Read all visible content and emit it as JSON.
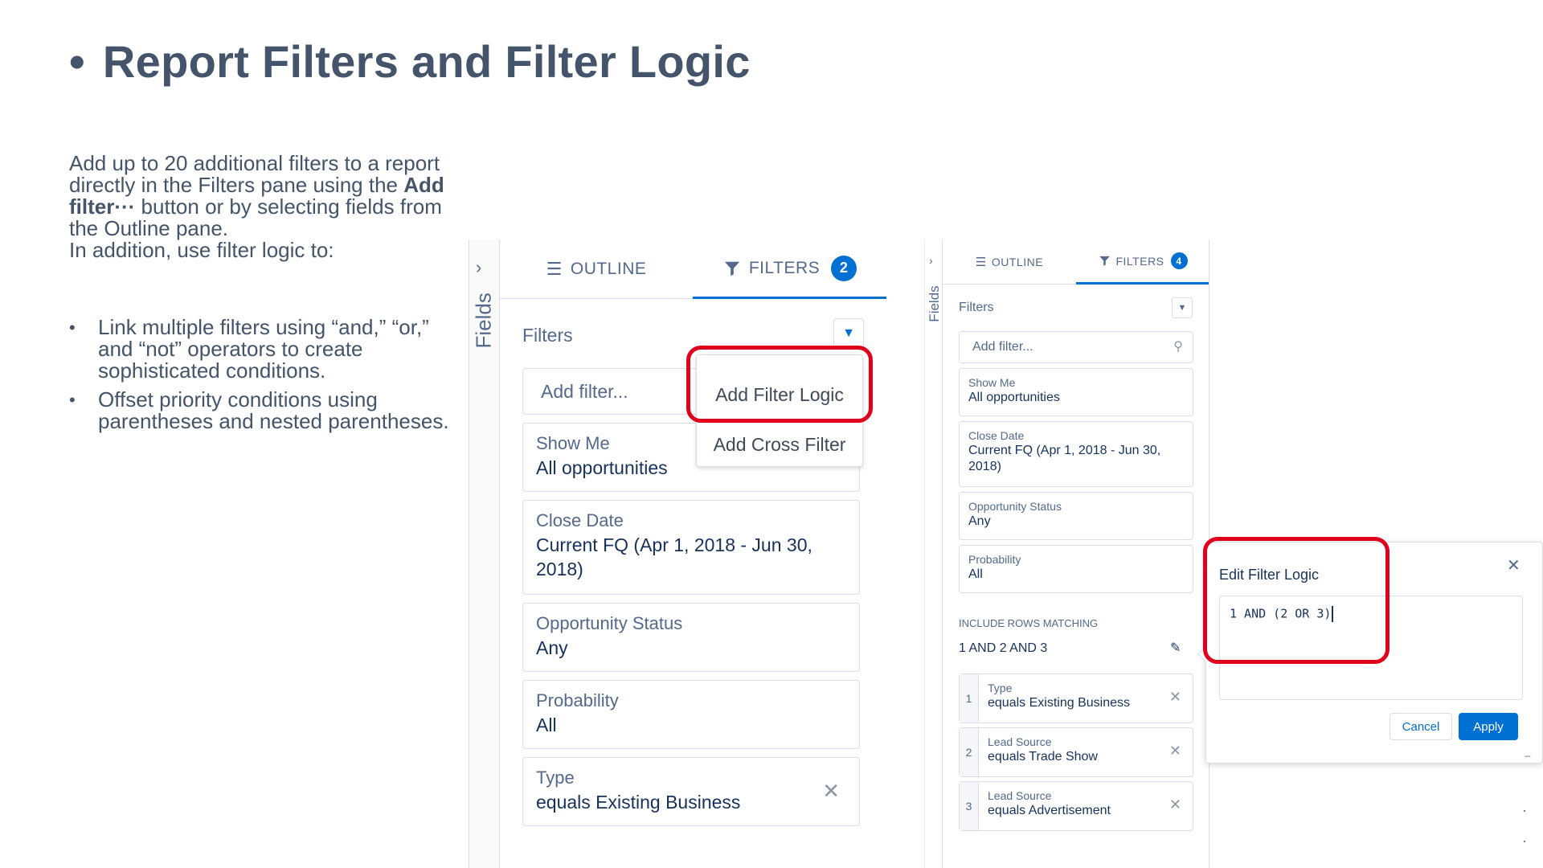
{
  "slide": {
    "title": "Report Filters and Filter Logic",
    "intro_1": "Add up to 20 additional filters to a report directly in the Filters pane using the ",
    "intro_bold": "Add filter···",
    "intro_2": " button or by selecting  fields from the Outline pane.",
    "intro_3": "In addition, use filter logic to:",
    "bullets": [
      "Link multiple filters using “and,” “or,” and “not” operators to create sophisticated conditions.",
      "Offset priority conditions using parentheses and nested parentheses."
    ]
  },
  "left_panel": {
    "rail_label": "Fields",
    "tab_outline": "Outline",
    "tab_filters": "Filters",
    "filters_badge": "2",
    "filters_title": "Filters",
    "add_filter_placeholder": "Add filter...",
    "menu": [
      "Add Filter Logic",
      "Add Cross Filter"
    ],
    "cards": [
      {
        "label": "Show Me",
        "value": "All opportunities"
      },
      {
        "label": "Close Date",
        "value": "Current FQ (Apr 1, 2018 - Jun 30, 2018)"
      },
      {
        "label": "Opportunity Status",
        "value": "Any"
      },
      {
        "label": "Probability",
        "value": "All"
      },
      {
        "label": "Type",
        "value": "equals Existing Business"
      }
    ]
  },
  "right_panel": {
    "rail_label": "Fields",
    "tab_outline": "Outline",
    "tab_filters": "Filters",
    "filters_badge": "4",
    "filters_title": "Filters",
    "add_filter_placeholder": "Add filter...",
    "cards": [
      {
        "label": "Show Me",
        "value": "All opportunities"
      },
      {
        "label": "Close Date",
        "value": "Current FQ (Apr 1, 2018 - Jun 30, 2018)"
      },
      {
        "label": "Opportunity Status",
        "value": "Any"
      },
      {
        "label": "Probability",
        "value": "All"
      }
    ],
    "include_rows_label": "Include rows matching",
    "logic": "1 AND 2 AND 3",
    "numbered": [
      {
        "num": "1",
        "label": "Type",
        "value": "equals Existing Business"
      },
      {
        "num": "2",
        "label": "Lead Source",
        "value": "equals Trade Show"
      },
      {
        "num": "3",
        "label": "Lead Source",
        "value": "equals Advertisement"
      }
    ]
  },
  "popover": {
    "title": "Edit Filter Logic",
    "value": "1 AND (2 OR 3)",
    "cancel": "Cancel",
    "apply": "Apply"
  },
  "colors": {
    "title_text": "#44546a",
    "accent": "#0070d2",
    "highlight": "#e0001b",
    "text_primary": "#16325c",
    "text_secondary": "#54698d",
    "border": "#d8dde6"
  },
  "icons": [
    "list-icon",
    "funnel-icon",
    "chevron-right-icon",
    "chevron-down-icon",
    "search-icon",
    "close-icon",
    "pencil-icon"
  ]
}
